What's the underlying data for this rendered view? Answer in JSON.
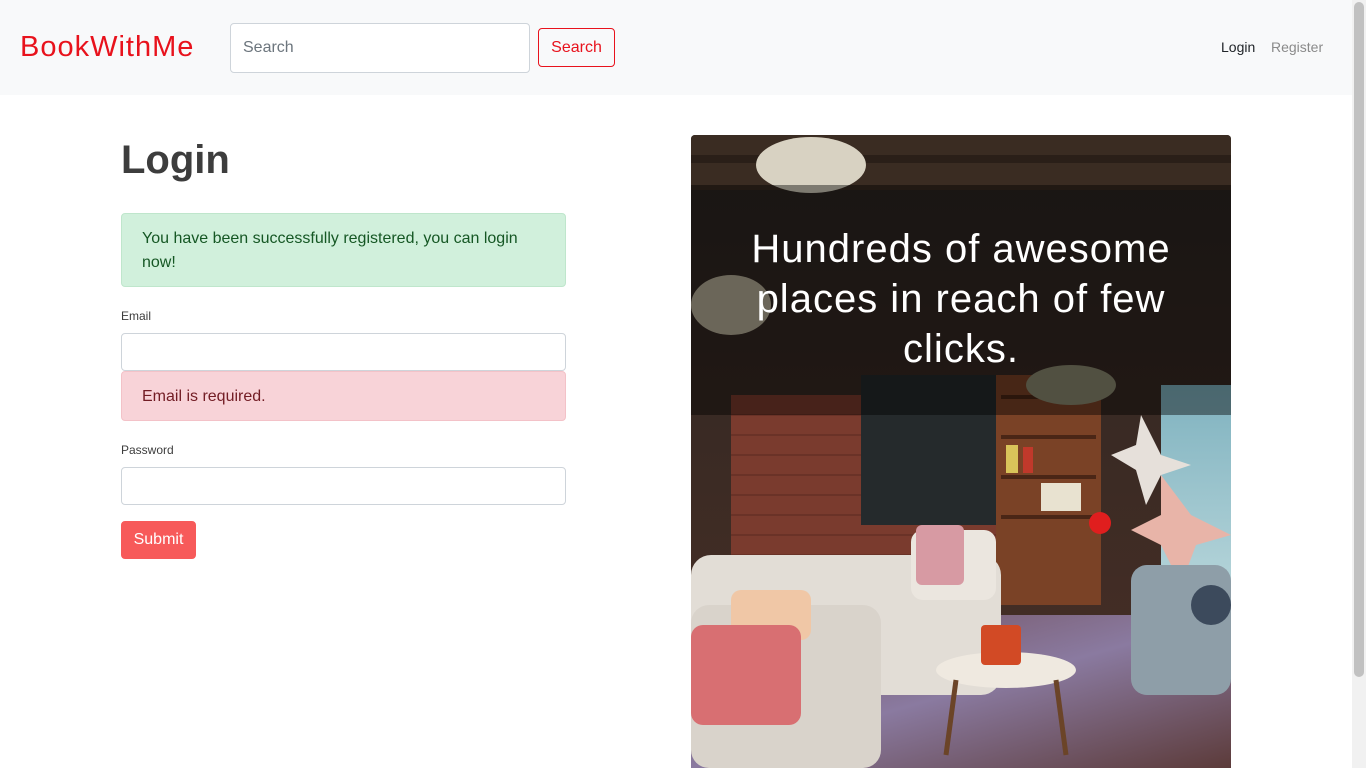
{
  "navbar": {
    "brand": "BookWithMe",
    "search": {
      "placeholder": "Search",
      "value": ""
    },
    "search_button": "Search",
    "links": {
      "login": "Login",
      "register": "Register"
    }
  },
  "login": {
    "title": "Login",
    "success_alert": "You have been successfully registered, you can login now!",
    "email": {
      "label": "Email",
      "value": "",
      "error": "Email is required."
    },
    "password": {
      "label": "Password",
      "value": ""
    },
    "submit": "Submit"
  },
  "hero": {
    "headline": "Hundreds of awesome places in reach of few clicks."
  },
  "colors": {
    "brand": "#e8121c",
    "submit": "#f75a5a",
    "success_bg": "#d1f0dc",
    "danger_bg": "#f8d3d8"
  }
}
